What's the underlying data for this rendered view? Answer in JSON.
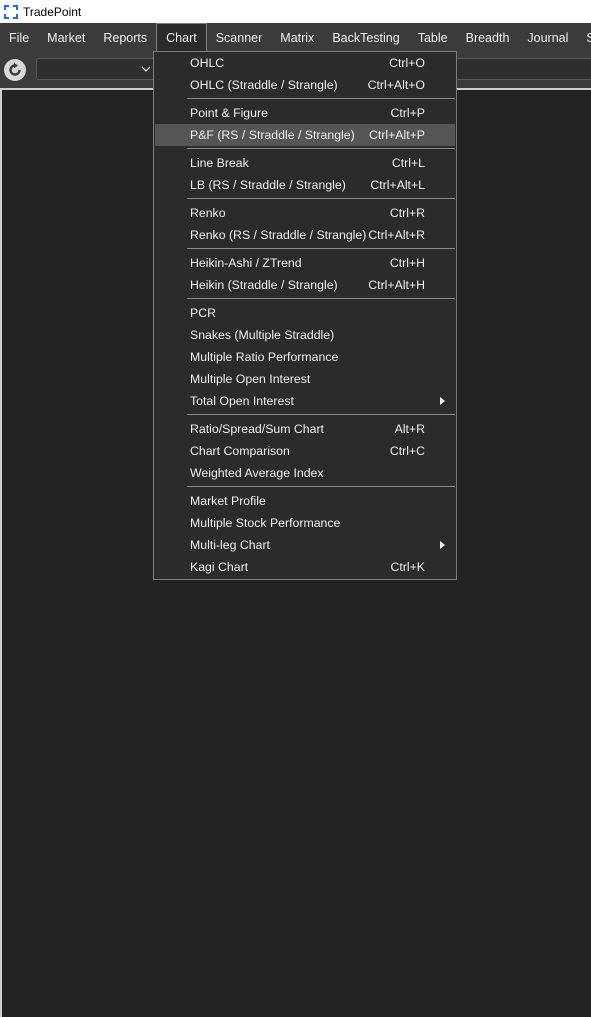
{
  "app": {
    "title": "TradePoint"
  },
  "menubar": {
    "items": [
      "File",
      "Market",
      "Reports",
      "Chart",
      "Scanner",
      "Matrix",
      "BackTesting",
      "Table",
      "Breadth",
      "Journal",
      "Setti"
    ],
    "active": "Chart"
  },
  "toolbar": {
    "refresh_icon": "refresh-icon",
    "symbol_select_value": ""
  },
  "chart_menu": {
    "groups": [
      [
        {
          "label": "OHLC",
          "shortcut": "Ctrl+O"
        },
        {
          "label": "OHLC (Straddle / Strangle)",
          "shortcut": "Ctrl+Alt+O"
        }
      ],
      [
        {
          "label": "Point & Figure",
          "shortcut": "Ctrl+P"
        },
        {
          "label": "P&F (RS / Straddle / Strangle)",
          "shortcut": "Ctrl+Alt+P",
          "highlighted": true
        }
      ],
      [
        {
          "label": "Line Break",
          "shortcut": "Ctrl+L"
        },
        {
          "label": "LB (RS / Straddle / Strangle)",
          "shortcut": "Ctrl+Alt+L"
        }
      ],
      [
        {
          "label": "Renko",
          "shortcut": "Ctrl+R"
        },
        {
          "label": "Renko (RS / Straddle / Strangle)",
          "shortcut": "Ctrl+Alt+R"
        }
      ],
      [
        {
          "label": "Heikin-Ashi / ZTrend",
          "shortcut": "Ctrl+H"
        },
        {
          "label": "Heikin (Straddle / Strangle)",
          "shortcut": "Ctrl+Alt+H"
        }
      ],
      [
        {
          "label": "PCR",
          "shortcut": ""
        },
        {
          "label": "Snakes (Multiple Straddle)",
          "shortcut": ""
        },
        {
          "label": "Multiple Ratio Performance",
          "shortcut": ""
        },
        {
          "label": "Multiple Open Interest",
          "shortcut": ""
        },
        {
          "label": "Total Open Interest",
          "shortcut": "",
          "submenu": true
        }
      ],
      [
        {
          "label": "Ratio/Spread/Sum Chart",
          "shortcut": "Alt+R"
        },
        {
          "label": "Chart Comparison",
          "shortcut": "Ctrl+C"
        },
        {
          "label": "Weighted Average Index",
          "shortcut": ""
        }
      ],
      [
        {
          "label": "Market Profile",
          "shortcut": ""
        },
        {
          "label": "Multiple Stock Performance",
          "shortcut": ""
        },
        {
          "label": "Multi-leg Chart",
          "shortcut": "",
          "submenu": true
        },
        {
          "label": "Kagi Chart",
          "shortcut": "Ctrl+K"
        }
      ]
    ]
  }
}
